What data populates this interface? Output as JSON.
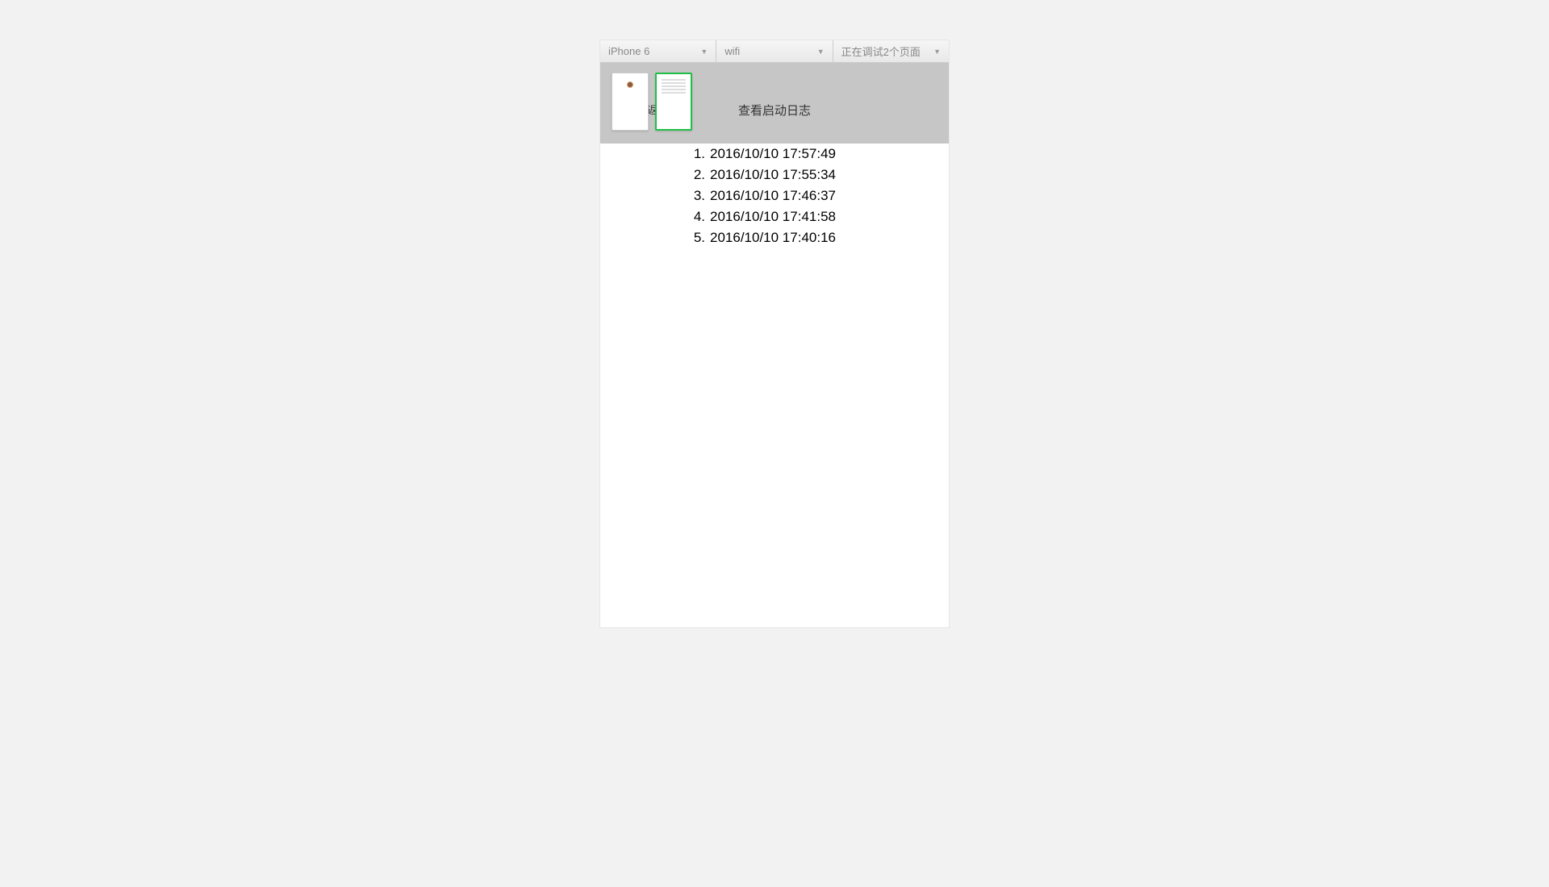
{
  "toolbar": {
    "device": "iPhone 6",
    "network": "wifi",
    "debug": "正在调试2个页面"
  },
  "header": {
    "back": "返回",
    "title": "查看启动日志"
  },
  "logs": [
    {
      "num": "1.",
      "ts": "2016/10/10 17:57:49"
    },
    {
      "num": "2.",
      "ts": "2016/10/10 17:55:34"
    },
    {
      "num": "3.",
      "ts": "2016/10/10 17:46:37"
    },
    {
      "num": "4.",
      "ts": "2016/10/10 17:41:58"
    },
    {
      "num": "5.",
      "ts": "2016/10/10 17:40:16"
    }
  ]
}
